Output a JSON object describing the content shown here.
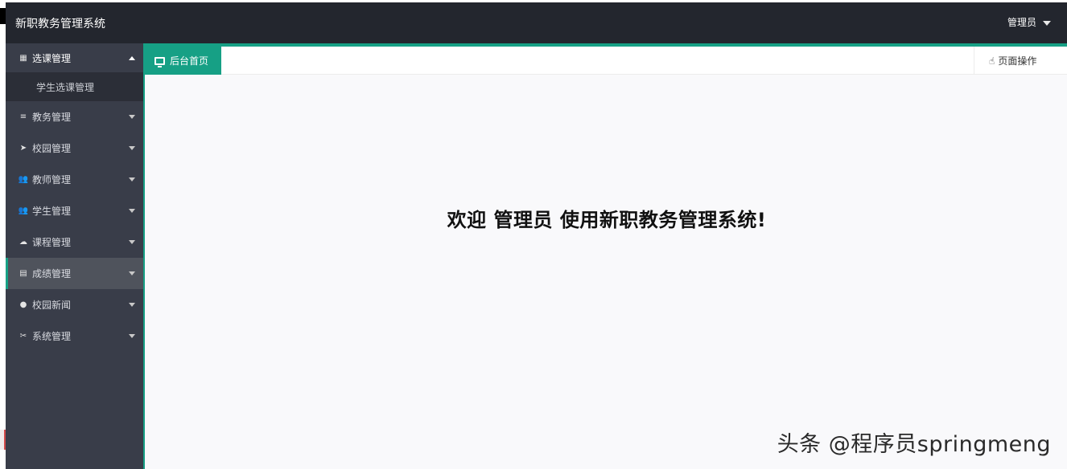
{
  "header": {
    "app_title": "新职教务管理系统",
    "user_label": "管理员"
  },
  "sidebar": {
    "items": [
      {
        "label": "选课管理",
        "icon": "grid-icon",
        "open": true,
        "sub": [
          "学生选课管理"
        ]
      },
      {
        "label": "教务管理",
        "icon": "list-icon"
      },
      {
        "label": "校园管理",
        "icon": "send-icon"
      },
      {
        "label": "教师管理",
        "icon": "users-icon"
      },
      {
        "label": "学生管理",
        "icon": "users-icon"
      },
      {
        "label": "课程管理",
        "icon": "cloud-icon"
      },
      {
        "label": "成绩管理",
        "icon": "chart-icon",
        "active": true
      },
      {
        "label": "校园新闻",
        "icon": "circle-icon"
      },
      {
        "label": "系统管理",
        "icon": "tools-icon"
      }
    ]
  },
  "tabs": {
    "home_label": "后台首页",
    "page_ops_label": "页面操作"
  },
  "main": {
    "welcome_text": "欢迎 管理员 使用新职教务管理系统!"
  },
  "watermark": {
    "text": "头条 @程序员springmeng"
  },
  "colors": {
    "accent": "#16a085",
    "topbar": "#23262e",
    "sidebar": "#393d49"
  }
}
